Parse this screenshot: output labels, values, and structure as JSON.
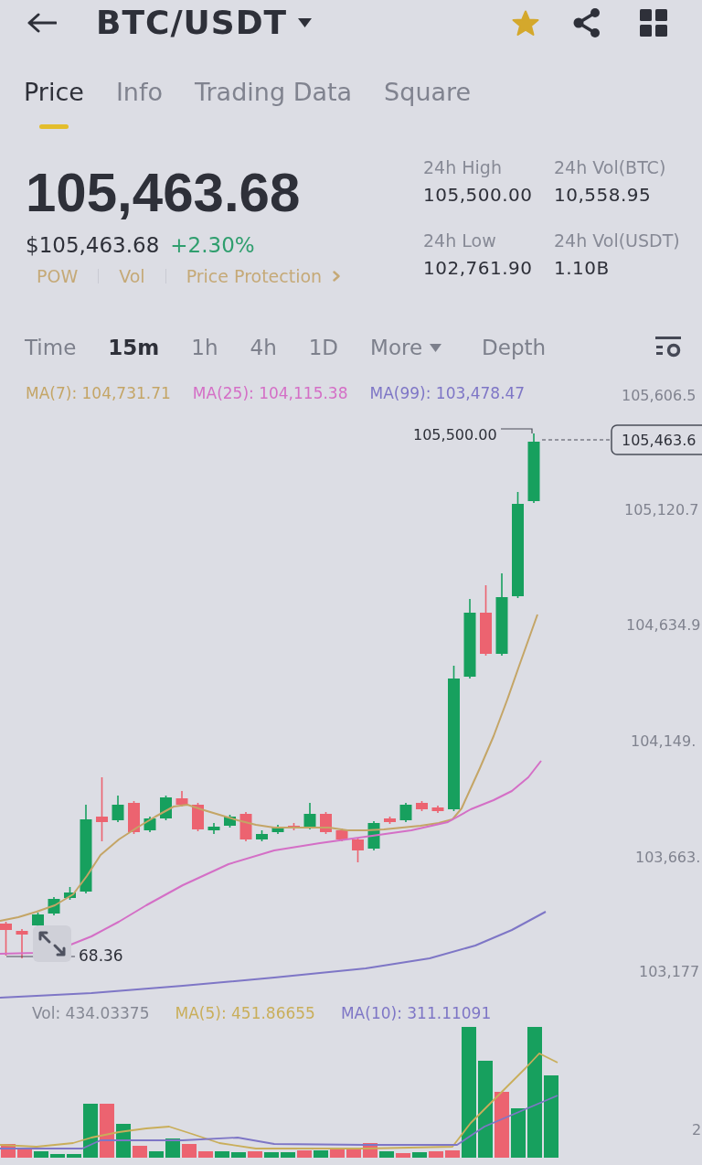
{
  "header": {
    "title": "BTC/USDT",
    "favorite": true
  },
  "tabs": [
    {
      "label": "Price",
      "selected": true
    },
    {
      "label": "Info",
      "selected": false
    },
    {
      "label": "Trading Data",
      "selected": false
    },
    {
      "label": "Square",
      "selected": false
    }
  ],
  "ticker": {
    "last_price": "105,463.68",
    "fiat_price": "$105,463.68",
    "change": "+2.30%",
    "tags": [
      {
        "label": "POW",
        "kind": "tag"
      },
      {
        "label": "Vol",
        "kind": "tag"
      },
      {
        "label": "Price Protection",
        "kind": "link"
      }
    ]
  },
  "stats": [
    {
      "label": "24h High",
      "value": "105,500.00"
    },
    {
      "label": "24h Vol(BTC)",
      "value": "10,558.95"
    },
    {
      "label": "24h Low",
      "value": "102,761.90"
    },
    {
      "label": "24h Vol(USDT)",
      "value": "1.10B"
    }
  ],
  "intervals": [
    {
      "label": "Time",
      "selected": false,
      "kind": "option"
    },
    {
      "label": "15m",
      "selected": true,
      "kind": "option"
    },
    {
      "label": "1h",
      "selected": false,
      "kind": "option"
    },
    {
      "label": "4h",
      "selected": false,
      "kind": "option"
    },
    {
      "label": "1D",
      "selected": false,
      "kind": "option"
    },
    {
      "label": "More",
      "selected": false,
      "kind": "menu"
    },
    {
      "label": "Depth",
      "selected": false,
      "kind": "view"
    }
  ],
  "price_chart": {
    "indicators": [
      {
        "label": "MA(7): 104,731.71",
        "color": "#c4a566"
      },
      {
        "label": "MA(25): 104,115.38",
        "color": "#d46fc6"
      },
      {
        "label": "MA(99): 103,478.47",
        "color": "#7e76c6"
      }
    ],
    "axis_labels": [
      "105,606.5",
      "105,120.7",
      "104,634.9",
      "104,149.",
      "103,663.",
      "103,177"
    ],
    "high_label": "105,500.00",
    "last_price_tag": "105,463.6",
    "low_label": "68.36"
  },
  "volume_chart": {
    "indicators": [
      {
        "label": "Vol: 434.03375",
        "color": "#858894"
      },
      {
        "label": "MA(5): 451.86655",
        "color": "#c9ae5a"
      },
      {
        "label": "MA(10): 311.11091",
        "color": "#7e76c6"
      }
    ],
    "axis_labels": [
      "2"
    ]
  }
}
